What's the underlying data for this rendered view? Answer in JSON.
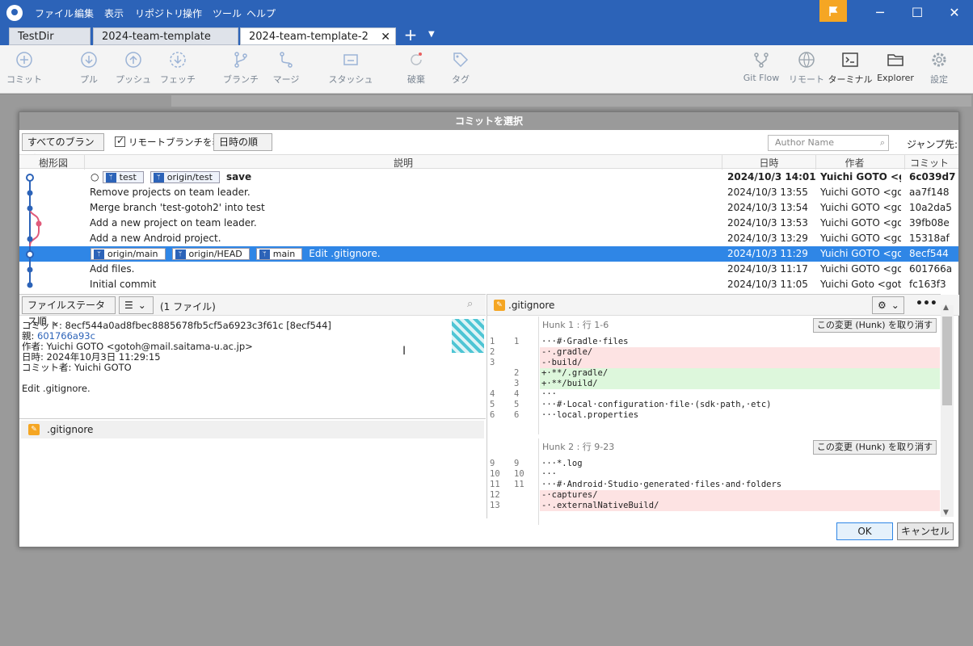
{
  "menu": [
    "ファイル",
    "編集",
    "表示",
    "リポジトリ",
    "操作",
    "ツール",
    "ヘルプ"
  ],
  "tabs": [
    {
      "label": "TestDir"
    },
    {
      "label": "2024-team-template"
    },
    {
      "label": "2024-team-template-2"
    }
  ],
  "toolbar": {
    "commit": "コミット",
    "pull": "プル",
    "push": "プッシュ",
    "fetch": "フェッチ",
    "branch": "ブランチ",
    "merge": "マージ",
    "stash": "スタッシュ",
    "discard": "破棄",
    "tag": "タグ",
    "gitflow": "Git Flow",
    "remote": "リモート",
    "terminal": "ターミナル",
    "explorer": "Explorer",
    "settings": "設定"
  },
  "dialog": {
    "title": "コミットを選択",
    "branch_filter": "すべてのブランチ",
    "show_remote_label": "リモートブランチを表示",
    "sort": "日時の順",
    "author_placeholder": "Author Name",
    "jump_label": "ジャンプ先:",
    "columns": {
      "graph": "樹形図",
      "description": "説明",
      "date": "日時",
      "author": "作者",
      "commit": "コミット"
    },
    "ok": "OK",
    "cancel": "キャンセル"
  },
  "commits": [
    {
      "refs": [
        "test",
        "origin/test"
      ],
      "message": "save",
      "date": "2024/10/3  14:01",
      "author": "Yuichi GOTO <got",
      "hash": "6c039d7",
      "bold": true
    },
    {
      "refs": [],
      "message": "Remove projects on team leader.",
      "date": "2024/10/3  13:55",
      "author": "Yuichi GOTO <goto",
      "hash": "aa7f148"
    },
    {
      "refs": [],
      "message": "Merge branch 'test-gotoh2' into test",
      "date": "2024/10/3  13:54",
      "author": "Yuichi GOTO <goto",
      "hash": "10a2da5"
    },
    {
      "refs": [],
      "message": "Add a new project on team leader.",
      "date": "2024/10/3  13:53",
      "author": "Yuichi GOTO <goto",
      "hash": "39fb08e"
    },
    {
      "refs": [],
      "message": "Add a new Android project.",
      "date": "2024/10/3  13:29",
      "author": "Yuichi GOTO <goto",
      "hash": "15318af"
    },
    {
      "refs": [
        "origin/main",
        "origin/HEAD",
        "main"
      ],
      "message": "Edit .gitignore.",
      "date": "2024/10/3  11:29",
      "author": "Yuichi GOTO <goto",
      "hash": "8ecf544",
      "selected": true
    },
    {
      "refs": [],
      "message": "Add files.",
      "date": "2024/10/3  11:17",
      "author": "Yuichi GOTO <goto",
      "hash": "601766a"
    },
    {
      "refs": [],
      "message": "Initial commit",
      "date": "2024/10/3  11:05",
      "author": "Yuichi Goto <goto",
      "hash": "fc163f3"
    }
  ],
  "file_panel": {
    "sort": "ファイルステータス順",
    "file_count": "(1 ファイル)",
    "commit_line": "コミット: 8ecf544a0ad8fbec8885678fb5cf5a6923c3f61c [8ecf544]",
    "parent_label": "親: ",
    "parent_hash": "601766a93c",
    "author_line": "作者: Yuichi GOTO <gotoh@mail.saitama-u.ac.jp>",
    "date_line": "日時: 2024年10月3日 11:29:15",
    "committer_line": "コミット者: Yuichi GOTO",
    "message": "Edit .gitignore.",
    "files": [
      ".gitignore"
    ]
  },
  "diff": {
    "filename": ".gitignore",
    "discard_hunk": "この変更 (Hunk) を取り消す",
    "hunks": [
      {
        "title": "Hunk 1 : 行 1-6",
        "lines": [
          {
            "o": "1",
            "n": "1",
            "t": "···#·Gradle·files",
            "k": "ctx"
          },
          {
            "o": "2",
            "n": "",
            "t": "-·.gradle/",
            "k": "del"
          },
          {
            "o": "3",
            "n": "",
            "t": "-·build/",
            "k": "del"
          },
          {
            "o": "",
            "n": "2",
            "t": "+·**/.gradle/",
            "k": "add"
          },
          {
            "o": "",
            "n": "3",
            "t": "+·**/build/",
            "k": "add"
          },
          {
            "o": "4",
            "n": "4",
            "t": "···",
            "k": "ctx"
          },
          {
            "o": "5",
            "n": "5",
            "t": "···#·Local·configuration·file·(sdk·path,·etc)",
            "k": "ctx"
          },
          {
            "o": "6",
            "n": "6",
            "t": "···local.properties",
            "k": "ctx"
          }
        ]
      },
      {
        "title": "Hunk 2 : 行 9-23",
        "lines": [
          {
            "o": "9",
            "n": "9",
            "t": "···*.log",
            "k": "ctx"
          },
          {
            "o": "10",
            "n": "10",
            "t": "···",
            "k": "ctx"
          },
          {
            "o": "11",
            "n": "11",
            "t": "···#·Android·Studio·generated·files·and·folders",
            "k": "ctx"
          },
          {
            "o": "12",
            "n": "",
            "t": "-·captures/",
            "k": "del"
          },
          {
            "o": "13",
            "n": "",
            "t": "-·.externalNativeBuild/",
            "k": "del"
          }
        ]
      }
    ]
  },
  "colors": {
    "accent": "#2c63b8",
    "selection": "#2f86e6",
    "flag": "#f5a623"
  }
}
